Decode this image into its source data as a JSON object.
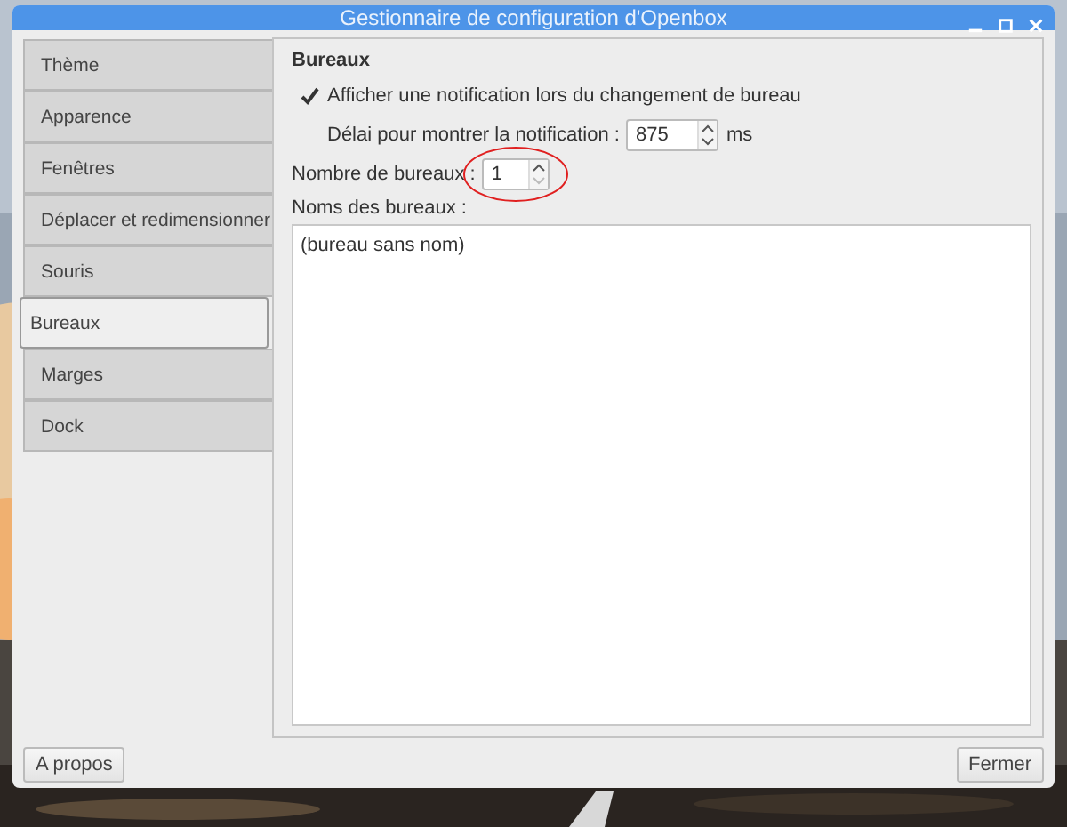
{
  "window": {
    "title": "Gestionnaire de configuration d'Openbox"
  },
  "tabs": [
    {
      "label": "Thème",
      "selected": false
    },
    {
      "label": "Apparence",
      "selected": false
    },
    {
      "label": "Fenêtres",
      "selected": false
    },
    {
      "label": "Déplacer et redimensionner",
      "selected": false
    },
    {
      "label": "Souris",
      "selected": false
    },
    {
      "label": "Bureaux",
      "selected": true
    },
    {
      "label": "Marges",
      "selected": false
    },
    {
      "label": "Dock",
      "selected": false
    }
  ],
  "section": {
    "title": "Bureaux",
    "notify": {
      "label": "Afficher une notification lors du changement de bureau",
      "checked": true
    },
    "delay": {
      "label": "Délai pour montrer la notification :",
      "value": "875",
      "unit": "ms"
    },
    "count": {
      "label": "Nombre de bureaux :",
      "value": "1"
    },
    "names": {
      "label": "Noms des bureaux :",
      "items": [
        "(bureau sans nom)"
      ]
    }
  },
  "buttons": {
    "left": "A propos",
    "right": "Fermer"
  }
}
